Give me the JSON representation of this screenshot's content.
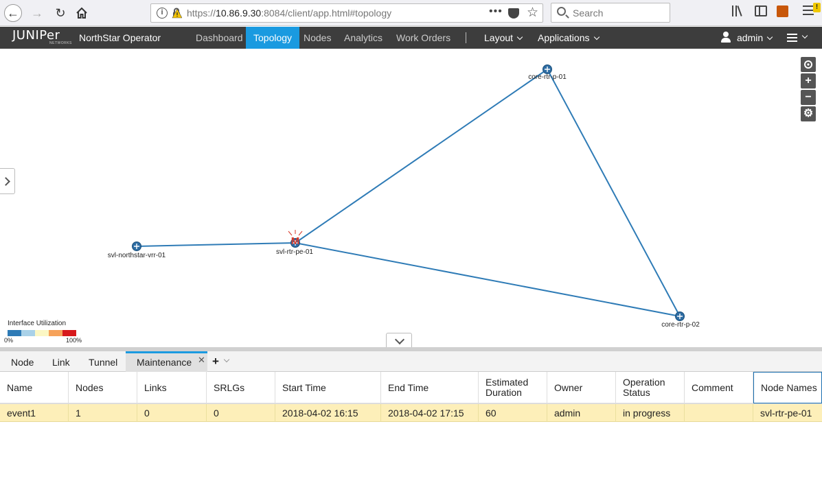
{
  "browser": {
    "url_prefix": "https://",
    "url_host": "10.86.9.30",
    "url_rest": ":8084/client/app.html#topology",
    "url_menu": "•••",
    "search_placeholder": "Search",
    "warning_badge": "!"
  },
  "header": {
    "logo": "JUNIPer",
    "logo_sub": "NETWORKS",
    "app_name": "NorthStar Operator",
    "tabs": [
      {
        "label": "Dashboard"
      },
      {
        "label": "Topology"
      },
      {
        "label": "Nodes"
      },
      {
        "label": "Analytics"
      },
      {
        "label": "Work Orders"
      }
    ],
    "layout_menu": "Layout",
    "applications_menu": "Applications",
    "user": "admin"
  },
  "topology": {
    "nodes": [
      {
        "name": "core-rtr-p-01"
      },
      {
        "name": "svl-northstar-vrr-01"
      },
      {
        "name": "svl-rtr-pe-01",
        "maintenance_mark": "M"
      },
      {
        "name": "core-rtr-p-02"
      }
    ],
    "link_color": "#2e7bb6",
    "maintenance_color": "#d93a2b",
    "legend": {
      "title": "Interface Utilization",
      "min": "0%",
      "max": "100%",
      "colors": [
        "#2e7bb6",
        "#a9d1e8",
        "#fbf7c4",
        "#f6a25a",
        "#d7191c"
      ]
    },
    "tools": [
      "target-icon",
      "zoom-in-icon",
      "zoom-out-icon",
      "settings-icon"
    ]
  },
  "bottom_tabs": {
    "tabs": [
      "Node",
      "Link",
      "Tunnel",
      "Maintenance"
    ],
    "active": "Maintenance",
    "close": "✕",
    "add": "+"
  },
  "table": {
    "columns": [
      "Name",
      "Nodes",
      "Links",
      "SRLGs",
      "Start Time",
      "End Time",
      "Estimated Duration",
      "Owner",
      "Operation Status",
      "Comment",
      "Node Names"
    ],
    "rows": [
      [
        "event1",
        "1",
        "0",
        "0",
        "2018-04-02 16:15",
        "2018-04-02 17:15",
        "60",
        "admin",
        "in progress",
        "",
        "svl-rtr-pe-01"
      ]
    ]
  }
}
